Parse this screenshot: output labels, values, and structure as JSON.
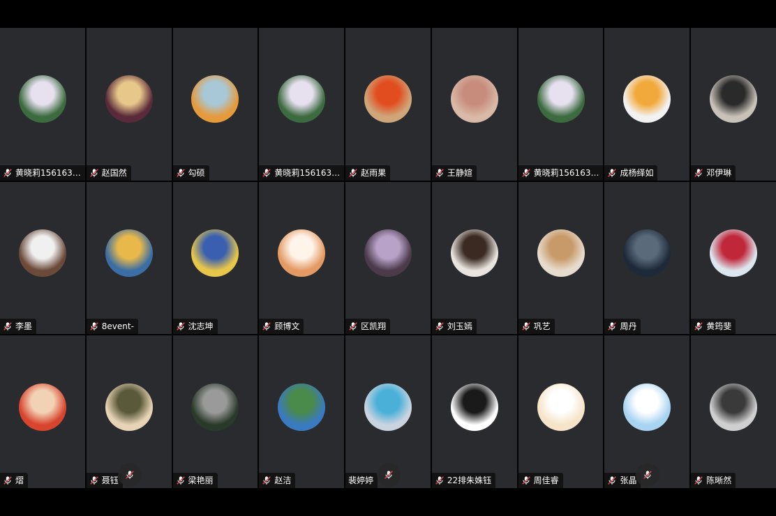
{
  "colors": {
    "muted_mic": "#e0464f",
    "tile_bg": "#2a2b2e",
    "top_bar": "#000000"
  },
  "participants": [
    {
      "name": "黄晓莉1561634...",
      "avatar": "wedding-photo-avatar",
      "bg": "#3c6b3f",
      "fg": "#e6e0ef"
    },
    {
      "name": "赵国然",
      "avatar": "anime-boy-avatar",
      "bg": "#5a2a3a",
      "fg": "#e8c78a"
    },
    {
      "name": "勾硕",
      "avatar": "toy-figure-avatar",
      "bg": "#e59a3c",
      "fg": "#a8c8d8"
    },
    {
      "name": "黄晓莉1561634...",
      "avatar": "wedding-photo-avatar",
      "bg": "#3c6b3f",
      "fg": "#e6e0ef"
    },
    {
      "name": "赵雨果",
      "avatar": "building-avatar",
      "bg": "#cfa67a",
      "fg": "#e24d1f"
    },
    {
      "name": "王静媗",
      "avatar": "girl-with-dog-avatar",
      "bg": "#d9b9a7",
      "fg": "#c78c7c"
    },
    {
      "name": "黄晓莉1561634...",
      "avatar": "wedding-photo-avatar",
      "bg": "#3c6b3f",
      "fg": "#e6e0ef"
    },
    {
      "name": "成杨绎如",
      "avatar": "cartoon-bear-pig-avatar",
      "bg": "#f2f2f2",
      "fg": "#f2a93b"
    },
    {
      "name": "邓伊琳",
      "avatar": "man-at-table-avatar",
      "bg": "#c8c2b8",
      "fg": "#2a2a2a"
    },
    {
      "name": "李墨",
      "avatar": "couple-avatar",
      "bg": "#6b4a3a",
      "fg": "#f0f0f0"
    },
    {
      "name": "8event-",
      "avatar": "hooded-figure-avatar",
      "bg": "#3b6ea5",
      "fg": "#e8b84a"
    },
    {
      "name": "沈志坤",
      "avatar": "mecha-robot-avatar",
      "bg": "#e7c64a",
      "fg": "#3a5fb0"
    },
    {
      "name": "顾博文",
      "avatar": "hand-avatar",
      "bg": "#e49a63",
      "fg": "#fff4ea"
    },
    {
      "name": "区凯翔",
      "avatar": "motorcycle-avatar",
      "bg": "#4a3a4a",
      "fg": "#b8a2c8"
    },
    {
      "name": "刘玉嫣",
      "avatar": "woman-back-avatar",
      "bg": "#e9e4df",
      "fg": "#3a2a22"
    },
    {
      "name": "巩艺",
      "avatar": "cat-avatar",
      "bg": "#e6dccd",
      "fg": "#c89a6a"
    },
    {
      "name": "周丹",
      "avatar": "tennis-racket-avatar",
      "bg": "#1e2a3a",
      "fg": "#5a6a7a"
    },
    {
      "name": "黄筠斐",
      "avatar": "skier-avatar",
      "bg": "#dce6ef",
      "fg": "#c0283a"
    },
    {
      "name": "熠",
      "avatar": "cartoon-girl-avatar",
      "bg": "#d8452f",
      "fg": "#f2d2b4"
    },
    {
      "name": "聂钰",
      "avatar": "mountain-sunset-avatar",
      "bg": "#e7d3b5",
      "fg": "#5a5a3a",
      "big_mic": true
    },
    {
      "name": "梁艳丽",
      "avatar": "helmet-rider-avatar",
      "bg": "#2a3a2a",
      "fg": "#9a9a9a"
    },
    {
      "name": "赵洁",
      "avatar": "coastal-town-avatar",
      "bg": "#3a7ac0",
      "fg": "#4a8a4a"
    },
    {
      "name": "裴婷婷",
      "avatar": "girl-at-beach-avatar",
      "bg": "#c9d4e0",
      "fg": "#4ab0d8",
      "no_mic": true,
      "big_mic": true
    },
    {
      "name": "22排朱姝钰",
      "avatar": "sketch-boy-avatar",
      "bg": "#ffffff",
      "fg": "#1a1a1a"
    },
    {
      "name": "周佳睿",
      "avatar": "cartoon-hamster-avatar",
      "bg": "#f6e4c8",
      "fg": "#ffffff"
    },
    {
      "name": "张晶",
      "avatar": "white-dog-avatar",
      "bg": "#a8d4f2",
      "fg": "#ffffff",
      "big_mic": true
    },
    {
      "name": "陈晰然",
      "avatar": "military-portrait-avatar",
      "bg": "#cfcfcf",
      "fg": "#3a3a3a"
    }
  ]
}
